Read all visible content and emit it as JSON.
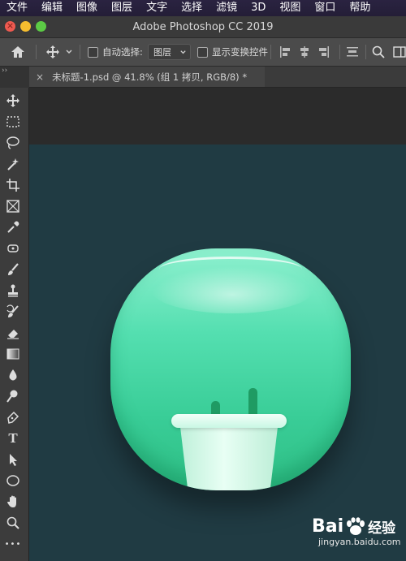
{
  "menubar": {
    "items": [
      "文件",
      "编辑",
      "图像",
      "图层",
      "文字",
      "选择",
      "滤镜",
      "3D",
      "视图",
      "窗口",
      "帮助"
    ]
  },
  "window": {
    "title": "Adobe Photoshop CC 2019"
  },
  "options": {
    "auto_select_label": "自动选择:",
    "layer_select_value": "图层",
    "show_transform_label": "显示变换控件"
  },
  "document": {
    "tab_title": "未标题-1.psd @ 41.8% (组 1 拷贝, RGB/8) *",
    "tab_close": "×"
  },
  "tools": [
    "move-tool",
    "marquee-tool",
    "lasso-tool",
    "magic-wand-tool",
    "crop-tool",
    "frame-tool",
    "eyedropper-tool",
    "healing-brush-tool",
    "brush-tool",
    "clone-stamp-tool",
    "history-brush-tool",
    "eraser-tool",
    "gradient-tool",
    "blur-tool",
    "dodge-tool",
    "pen-tool",
    "type-tool",
    "path-selection-tool",
    "shape-tool",
    "hand-tool",
    "zoom-tool",
    "more-tools"
  ],
  "type_tool_glyph": "T",
  "more_tools_glyph": "•••",
  "watermark": {
    "brand": "Bai",
    "brand_suffix": "经验",
    "url": "jingyan.baidu.com"
  },
  "colors": {
    "canvas": "#203b43",
    "icon_top": "#8ef0cf",
    "icon_bottom": "#2fbf85",
    "menubar": "#241e37"
  }
}
